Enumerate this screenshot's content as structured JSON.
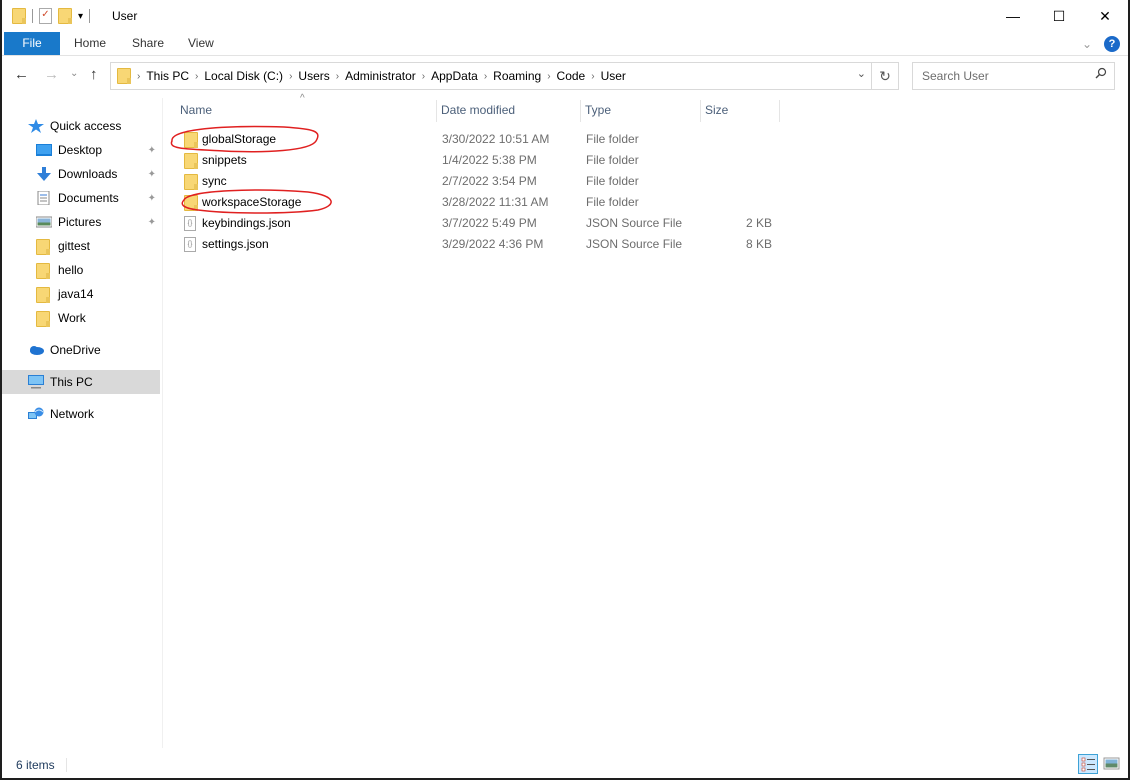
{
  "window": {
    "title": "User",
    "controls": {
      "minimize": "—",
      "maximize": "☐",
      "close": "✕"
    }
  },
  "ribbon": {
    "tabs": [
      "File",
      "Home",
      "Share",
      "View"
    ],
    "help_label": "?",
    "expand_icon": "⌄"
  },
  "navigation": {
    "back_icon": "←",
    "forward_icon": "→",
    "recent_icon": "⌄",
    "up_icon": "↑",
    "breadcrumb": [
      "This PC",
      "Local Disk (C:)",
      "Users",
      "Administrator",
      "AppData",
      "Roaming",
      "Code",
      "User"
    ],
    "chevron": "›",
    "dropdown_icon": "⌄",
    "refresh_icon": "↻"
  },
  "search": {
    "placeholder": "Search User",
    "value": "",
    "icon": "⚲"
  },
  "sidebar": {
    "items": [
      {
        "label": "Quick access",
        "icon": "star-icon",
        "pinned": false
      },
      {
        "label": "Desktop",
        "icon": "desktop-icon",
        "pinned": true
      },
      {
        "label": "Downloads",
        "icon": "download-icon",
        "pinned": true
      },
      {
        "label": "Documents",
        "icon": "documents-icon",
        "pinned": true
      },
      {
        "label": "Pictures",
        "icon": "pictures-icon",
        "pinned": true
      },
      {
        "label": "gittest",
        "icon": "folder-icon",
        "pinned": false
      },
      {
        "label": "hello",
        "icon": "folder-icon",
        "pinned": false
      },
      {
        "label": "java14",
        "icon": "folder-icon",
        "pinned": false
      },
      {
        "label": "Work",
        "icon": "folder-icon",
        "pinned": false
      },
      {
        "label": "OneDrive",
        "icon": "onedrive-icon",
        "pinned": false
      },
      {
        "label": "This PC",
        "icon": "computer-icon",
        "pinned": false,
        "selected": true
      },
      {
        "label": "Network",
        "icon": "network-icon",
        "pinned": false
      }
    ],
    "pin_glyph": "📌"
  },
  "file_list": {
    "columns": [
      "Name",
      "Date modified",
      "Type",
      "Size"
    ],
    "sort_indicator": "^",
    "rows": [
      {
        "name": "globalStorage",
        "date": "3/30/2022 10:51 AM",
        "type": "File folder",
        "size": "",
        "kind": "folder",
        "annotated": true
      },
      {
        "name": "snippets",
        "date": "1/4/2022 5:38 PM",
        "type": "File folder",
        "size": "",
        "kind": "folder",
        "annotated": false
      },
      {
        "name": "sync",
        "date": "2/7/2022 3:54 PM",
        "type": "File folder",
        "size": "",
        "kind": "folder",
        "annotated": false
      },
      {
        "name": "workspaceStorage",
        "date": "3/28/2022 11:31 AM",
        "type": "File folder",
        "size": "",
        "kind": "folder",
        "annotated": true
      },
      {
        "name": "keybindings.json",
        "date": "3/7/2022 5:49 PM",
        "type": "JSON Source File",
        "size": "2 KB",
        "kind": "json",
        "annotated": false
      },
      {
        "name": "settings.json",
        "date": "3/29/2022 4:36 PM",
        "type": "JSON Source File",
        "size": "8 KB",
        "kind": "json",
        "annotated": false
      }
    ]
  },
  "status": {
    "item_count": "6 items"
  },
  "colors": {
    "accent": "#1979ca",
    "annotation": "#e02020",
    "selected_nav": "#d9d9d9",
    "header_text": "#4c607a"
  }
}
